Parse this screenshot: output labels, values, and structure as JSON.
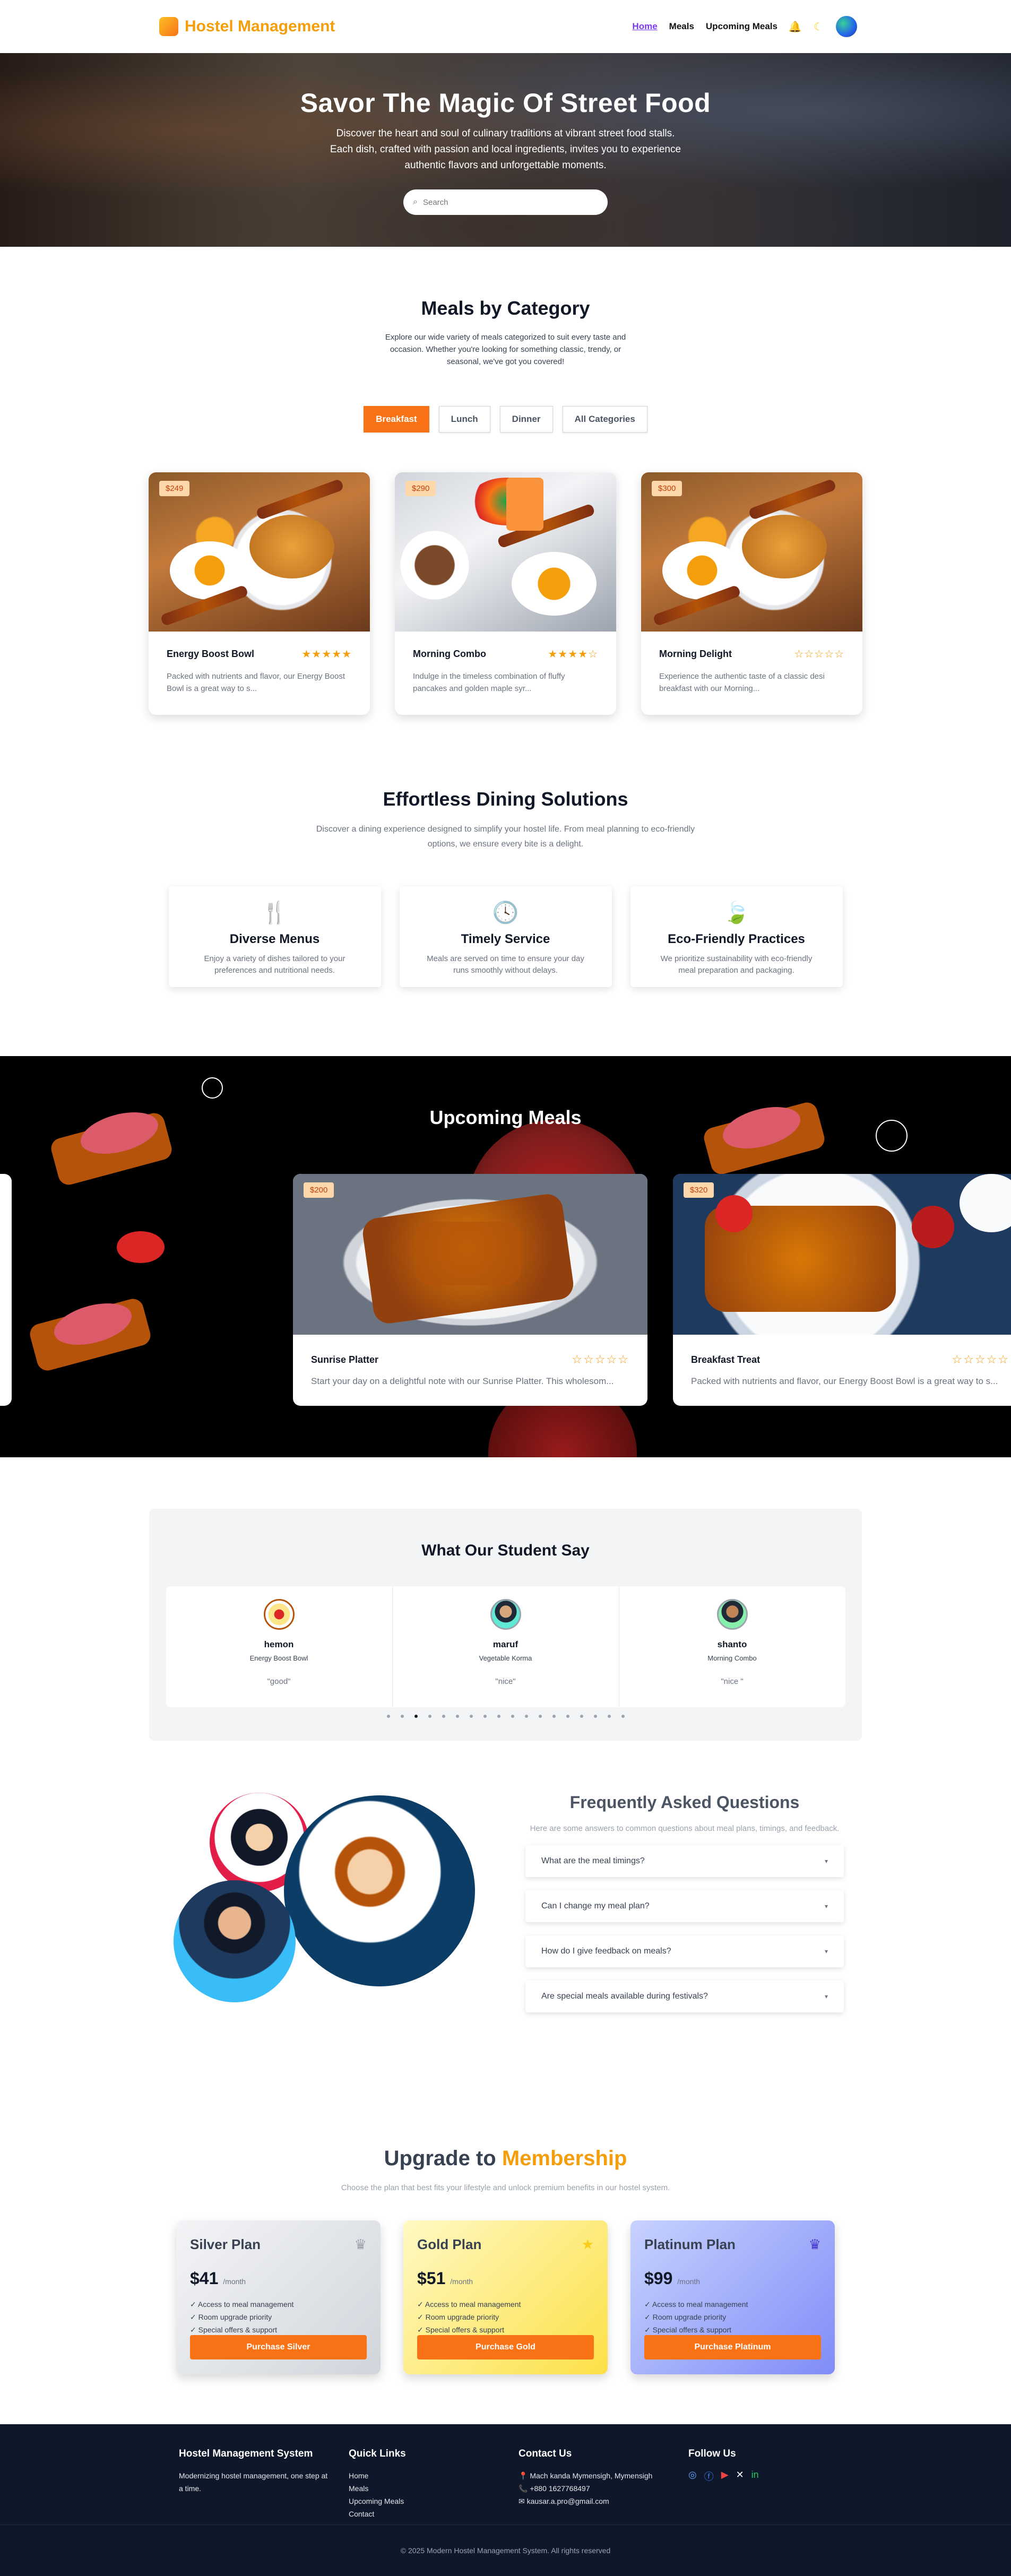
{
  "nav": {
    "brand": "Hostel Management",
    "links": [
      {
        "label": "Home"
      },
      {
        "label": "Meals"
      },
      {
        "label": "Upcoming Meals"
      }
    ]
  },
  "hero": {
    "title": "Savor The Magic Of Street Food",
    "description": "Discover the heart and soul of culinary traditions at vibrant street food stalls. Each dish, crafted with passion and local ingredients, invites you to experience authentic flavors and unforgettable moments.",
    "search_placeholder": "Search"
  },
  "category": {
    "title": "Meals by Category",
    "subtitle": "Explore our wide variety of meals categorized to suit every taste and occasion. Whether you're looking for something classic, trendy, or seasonal, we've got you covered!",
    "tabs": [
      "Breakfast",
      "Lunch",
      "Dinner",
      "All Categories"
    ],
    "active_tab": "Breakfast",
    "meals": [
      {
        "price": "$249",
        "name": "Energy Boost Bowl",
        "rating": 5,
        "desc": "Packed with nutrients and flavor, our Energy Boost Bowl is a great way to s..."
      },
      {
        "price": "$290",
        "name": "Morning Combo",
        "rating": 4,
        "desc": "Indulge in the timeless combination of fluffy pancakes and golden maple syr..."
      },
      {
        "price": "$300",
        "name": "Morning Delight",
        "rating": 0,
        "desc": "Experience the authentic taste of a classic desi breakfast with our Morning..."
      }
    ]
  },
  "dining": {
    "title": "Effortless Dining Solutions",
    "subtitle": "Discover a dining experience designed to simplify your hostel life. From meal planning to eco-friendly options, we ensure every bite is a delight.",
    "features": [
      {
        "icon": "utensils-icon",
        "title": "Diverse Menus",
        "desc": "Enjoy a variety of dishes tailored to your preferences and nutritional needs."
      },
      {
        "icon": "clock-icon",
        "title": "Timely Service",
        "desc": "Meals are served on time to ensure your day runs smoothly without delays."
      },
      {
        "icon": "leaf-icon",
        "title": "Eco-Friendly Practices",
        "desc": "We prioritize sustainability with eco-friendly meal preparation and packaging."
      }
    ]
  },
  "upcoming": {
    "title": "Upcoming Meals",
    "meals": [
      {
        "price": "$200",
        "name": "Sunrise Platter",
        "rating": 0,
        "desc": "Start your day on a delightful note with our Sunrise Platter. This wholesom..."
      },
      {
        "price": "$320",
        "name": "Breakfast Treat",
        "rating": 0,
        "desc": "Packed with nutrients and flavor, our Energy Boost Bowl is a great way to s..."
      }
    ]
  },
  "testimonials": {
    "title": "What Our Student Say",
    "items": [
      {
        "name": "hemon",
        "meal": "Energy Boost Bowl",
        "quote": "\"good\""
      },
      {
        "name": "maruf",
        "meal": "Vegetable Korma",
        "quote": "\"nice\""
      },
      {
        "name": "shanto",
        "meal": "Morning Combo",
        "quote": "\"nice \""
      }
    ],
    "dots_count": 18,
    "active_dot": 2
  },
  "faq": {
    "title": "Frequently Asked Questions",
    "subtitle": "Here are some answers to common questions about meal plans, timings, and feedback.",
    "questions": [
      "What are the meal timings?",
      "Can I change my meal plan?",
      "How do I give feedback on meals?",
      "Are special meals available during festivals?"
    ]
  },
  "membership": {
    "title_prefix": "Upgrade to",
    "title_highlight": "Membership",
    "subtitle": "Choose the plan that best fits your lifestyle and unlock premium benefits in our hostel system.",
    "plans": [
      {
        "name": "Silver Plan",
        "price": "$41",
        "per": "/month",
        "features": [
          "Access to meal management",
          "Room upgrade priority",
          "Special offers & support"
        ],
        "button": "Purchase Silver",
        "color": "#e5e7eb"
      },
      {
        "name": "Gold Plan",
        "price": "$51",
        "per": "/month",
        "features": [
          "Access to meal management",
          "Room upgrade priority",
          "Special offers & support"
        ],
        "button": "Purchase Gold",
        "color": "#fde68a"
      },
      {
        "name": "Platinum Plan",
        "price": "$99",
        "per": "/month",
        "features": [
          "Access to meal management",
          "Room upgrade priority",
          "Special offers & support"
        ],
        "button": "Purchase Platinum",
        "color": "#a5b4fc"
      }
    ]
  },
  "footer": {
    "about_title": "Hostel Management System",
    "about_text": "Modernizing hostel management, one step at a time.",
    "links_title": "Quick Links",
    "links": [
      "Home",
      "Meals",
      "Upcoming Meals",
      "Contact"
    ],
    "contact_title": "Contact Us",
    "contact": [
      "Mach kanda Mymensigh, Mymensigh",
      "+880 1627768497",
      "kausar.a.pro@gmail.com"
    ],
    "follow_title": "Follow Us",
    "copyright": "© 2025 Modern Hostel Management System. All rights reserved"
  }
}
